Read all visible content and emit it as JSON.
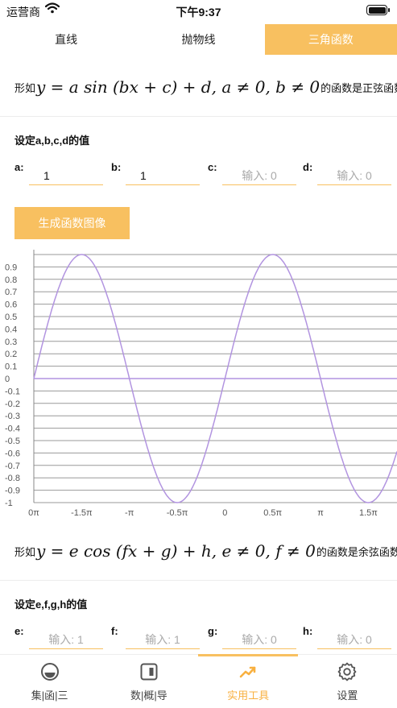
{
  "status_bar": {
    "carrier": "运营商",
    "time": "下午9:37"
  },
  "tabs": [
    {
      "label": "直线",
      "active": false
    },
    {
      "label": "抛物线",
      "active": false
    },
    {
      "label": "三角函数",
      "active": true
    }
  ],
  "sin_section": {
    "prefix": "形如",
    "formula": "y = a sin (bx + c) + d, a ≠ 0, b ≠ 0",
    "suffix": "的函数是正弦函数",
    "params_title": "设定a,b,c,d的值",
    "params": [
      {
        "label": "a:",
        "value": "1",
        "placeholder": ""
      },
      {
        "label": "b:",
        "value": "1",
        "placeholder": ""
      },
      {
        "label": "c:",
        "value": "",
        "placeholder": "输入: 0"
      },
      {
        "label": "d:",
        "value": "",
        "placeholder": "输入: 0"
      }
    ],
    "generate_button": "生成函数图像"
  },
  "cos_section": {
    "prefix": "形如",
    "formula": "y = e cos (fx + g) + h, e ≠ 0, f ≠ 0",
    "suffix": "的函数是余弦函数",
    "params_title": "设定e,f,g,h的值",
    "params": [
      {
        "label": "e:",
        "value": "",
        "placeholder": "输入: 1"
      },
      {
        "label": "f:",
        "value": "",
        "placeholder": "输入: 1"
      },
      {
        "label": "g:",
        "value": "",
        "placeholder": "输入: 0"
      },
      {
        "label": "h:",
        "value": "",
        "placeholder": "输入: 0"
      }
    ]
  },
  "chart_data": {
    "type": "line",
    "title": "",
    "xlabel": "",
    "ylabel": "",
    "function": "y = sin(x)",
    "x_unit": "π",
    "xlim": [
      -2.0,
      1.8
    ],
    "ylim": [
      -1,
      1
    ],
    "x_ticks": [
      {
        "value": -2.0,
        "label": "0π"
      },
      {
        "value": -1.5,
        "label": "-1.5π"
      },
      {
        "value": -1.0,
        "label": "-π"
      },
      {
        "value": -0.5,
        "label": "-0.5π"
      },
      {
        "value": 0,
        "label": "0"
      },
      {
        "value": 0.5,
        "label": "0.5π"
      },
      {
        "value": 1.0,
        "label": "π"
      },
      {
        "value": 1.5,
        "label": "1.5π"
      }
    ],
    "y_ticks": [
      {
        "value": 0.9,
        "label": "0.9"
      },
      {
        "value": 0.8,
        "label": "0.8"
      },
      {
        "value": 0.7,
        "label": "0.7"
      },
      {
        "value": 0.6,
        "label": "0.6"
      },
      {
        "value": 0.5,
        "label": "0.5"
      },
      {
        "value": 0.4,
        "label": "0.4"
      },
      {
        "value": 0.3,
        "label": "0.3"
      },
      {
        "value": 0.2,
        "label": "0.2"
      },
      {
        "value": 0.1,
        "label": "0.1"
      },
      {
        "value": 0,
        "label": "0"
      },
      {
        "value": -0.1,
        "label": "-0.1"
      },
      {
        "value": -0.2,
        "label": "-0.2"
      },
      {
        "value": -0.3,
        "label": "-0.3"
      },
      {
        "value": -0.4,
        "label": "-0.4"
      },
      {
        "value": -0.5,
        "label": "-0.5"
      },
      {
        "value": -0.6,
        "label": "-0.6"
      },
      {
        "value": -0.7,
        "label": "-0.7"
      },
      {
        "value": -0.8,
        "label": "-0.8"
      },
      {
        "value": -0.9,
        "label": "-0.9"
      },
      {
        "value": -1,
        "label": "-1"
      }
    ],
    "grid": true,
    "line_color": "#b294e0",
    "grid_color": "#999999"
  },
  "bottom_nav": [
    {
      "label": "集|函|三",
      "icon": "set-icon",
      "active": false
    },
    {
      "label": "数|概|导",
      "icon": "tablet-icon",
      "active": false
    },
    {
      "label": "实用工具",
      "icon": "trend-chart-icon",
      "active": true
    },
    {
      "label": "设置",
      "icon": "gear-icon",
      "active": false
    }
  ],
  "colors": {
    "accent": "#f8c060",
    "accent_text": "#f8b040",
    "curve": "#b294e0"
  }
}
